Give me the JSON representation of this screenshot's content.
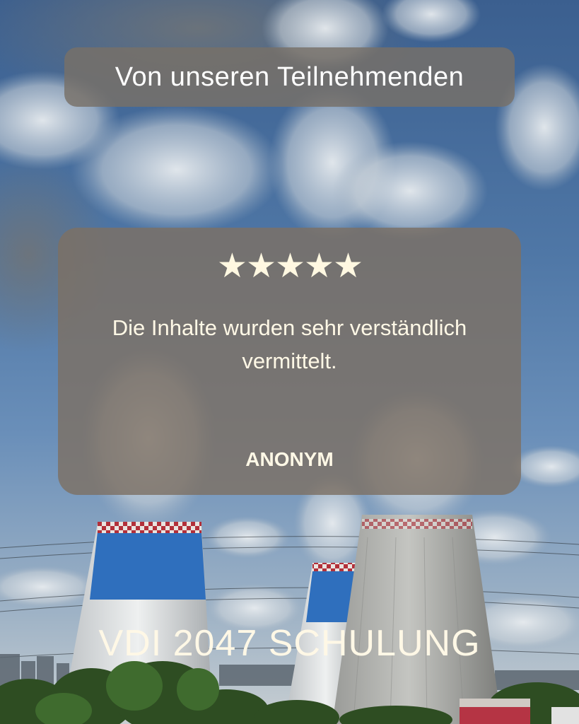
{
  "header": {
    "title": "Von unseren Teilnehmenden"
  },
  "review": {
    "rating": 5,
    "rating_max": 5,
    "stars_glyph": "★★★★★",
    "text": "Die Inhalte wurden sehr verständlich vermittelt.",
    "author": "ANONYM"
  },
  "footer": {
    "title": "VDI 2047 SCHULUNG"
  },
  "colors": {
    "text": "#fff8e6",
    "card": "#7d7064",
    "tower_band": "#2e6fbf",
    "sky": "#4f77a6"
  },
  "icons": {
    "rating": "star-icon"
  }
}
